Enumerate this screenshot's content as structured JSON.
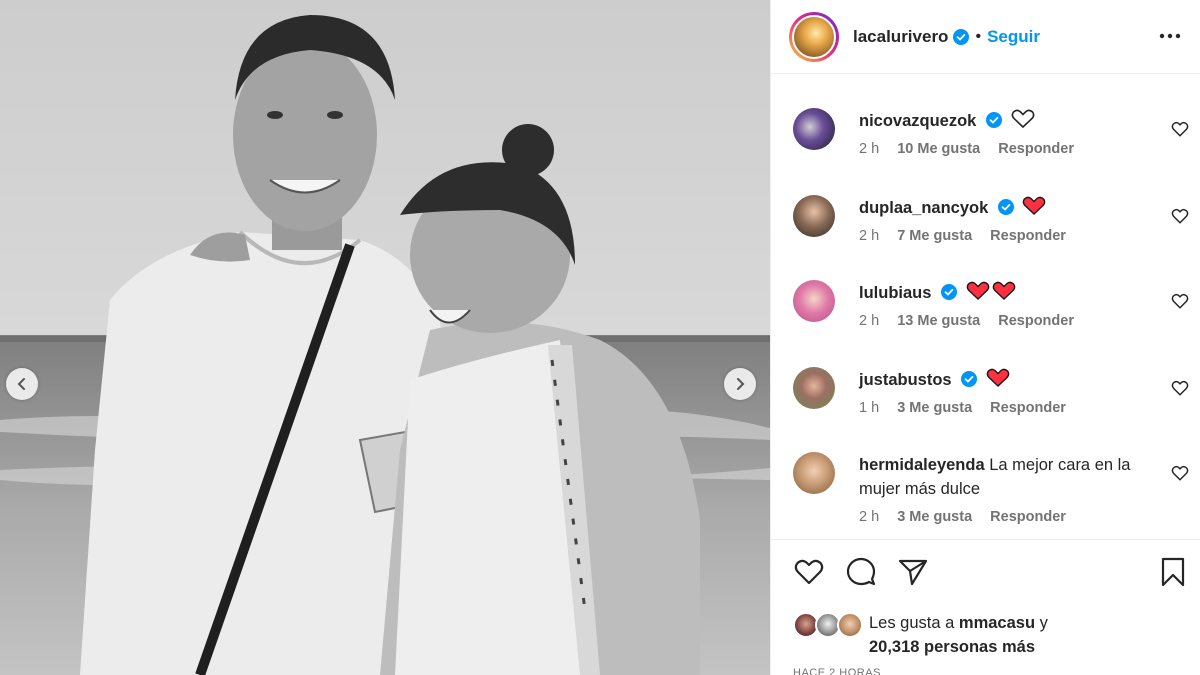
{
  "post": {
    "username": "lacalurivero",
    "follow_label": "Seguir",
    "dot": "•"
  },
  "comments": [
    {
      "user": "nicovazquezok",
      "text": "",
      "hearts": [
        "outline"
      ],
      "time": "2 h",
      "likes": "10 Me gusta",
      "reply": "Responder"
    },
    {
      "user": "duplaa_nancyok",
      "text": "",
      "hearts": [
        "red"
      ],
      "time": "2 h",
      "likes": "7 Me gusta",
      "reply": "Responder"
    },
    {
      "user": "lulubiaus",
      "text": "",
      "hearts": [
        "red",
        "red"
      ],
      "time": "2 h",
      "likes": "13 Me gusta",
      "reply": "Responder"
    },
    {
      "user": "justabustos",
      "text": "",
      "hearts": [
        "red"
      ],
      "time": "1 h",
      "likes": "3 Me gusta",
      "reply": "Responder"
    },
    {
      "user": "hermidaleyenda",
      "text": "La mejor cara en la mujer más dulce",
      "hearts": [],
      "time": "2 h",
      "likes": "3 Me gusta",
      "reply": "Responder"
    }
  ],
  "likes": {
    "prefix": "Les gusta a ",
    "user": "mmacasu",
    "middle": " y",
    "count": "20,318 personas más"
  },
  "timestamp": "HACE 2 HORAS",
  "colors": {
    "accent": "#0095f6",
    "heart_red": "#ff3040",
    "muted": "#737373"
  },
  "icons": {
    "prev": "chevron-left-icon",
    "next": "chevron-right-icon",
    "like": "heart-icon",
    "comment": "comment-icon",
    "share": "paper-plane-icon",
    "save": "bookmark-icon",
    "more": "more-options-icon",
    "verified": "verified-badge-icon"
  }
}
